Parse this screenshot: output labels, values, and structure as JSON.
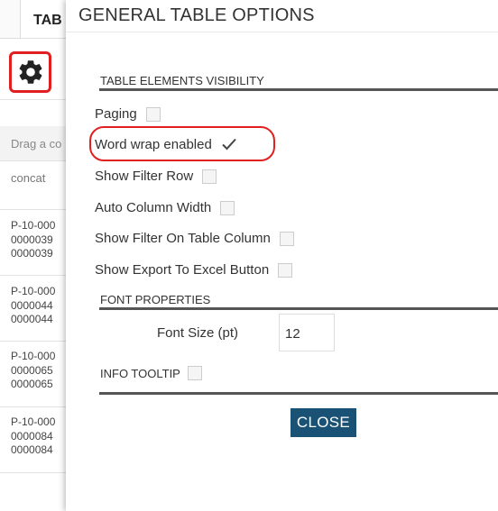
{
  "background": {
    "tab_label": "TAB",
    "drag_hint": "Drag a co",
    "column_header": "concat",
    "rows": [
      {
        "lines": [
          "P-10-000",
          "0000039",
          "0000039"
        ]
      },
      {
        "lines": [
          "P-10-000",
          "0000044",
          "0000044"
        ]
      },
      {
        "lines": [
          "P-10-000",
          "0000065",
          "0000065"
        ]
      },
      {
        "lines": [
          "P-10-000",
          "0000084",
          "0000084"
        ]
      }
    ]
  },
  "dialog": {
    "title": "GENERAL TABLE OPTIONS",
    "sections": {
      "visibility": "TABLE ELEMENTS VISIBILITY",
      "font": "FONT PROPERTIES",
      "info_tooltip": "INFO TOOLTIP"
    },
    "options": [
      {
        "label": "Paging",
        "checked": false
      },
      {
        "label": "Word wrap enabled",
        "checked": true
      },
      {
        "label": "Show Filter Row",
        "checked": false
      },
      {
        "label": "Auto Column Width",
        "checked": false
      },
      {
        "label": "Show Filter On Table Column",
        "checked": false
      },
      {
        "label": "Show Export To Excel Button",
        "checked": false
      }
    ],
    "info_tooltip_checked": false,
    "font_size_label": "Font Size (pt)",
    "font_size_value": "12",
    "close_label": "CLOSE"
  },
  "colors": {
    "accent": "#1a5276",
    "highlight": "#e02020"
  }
}
